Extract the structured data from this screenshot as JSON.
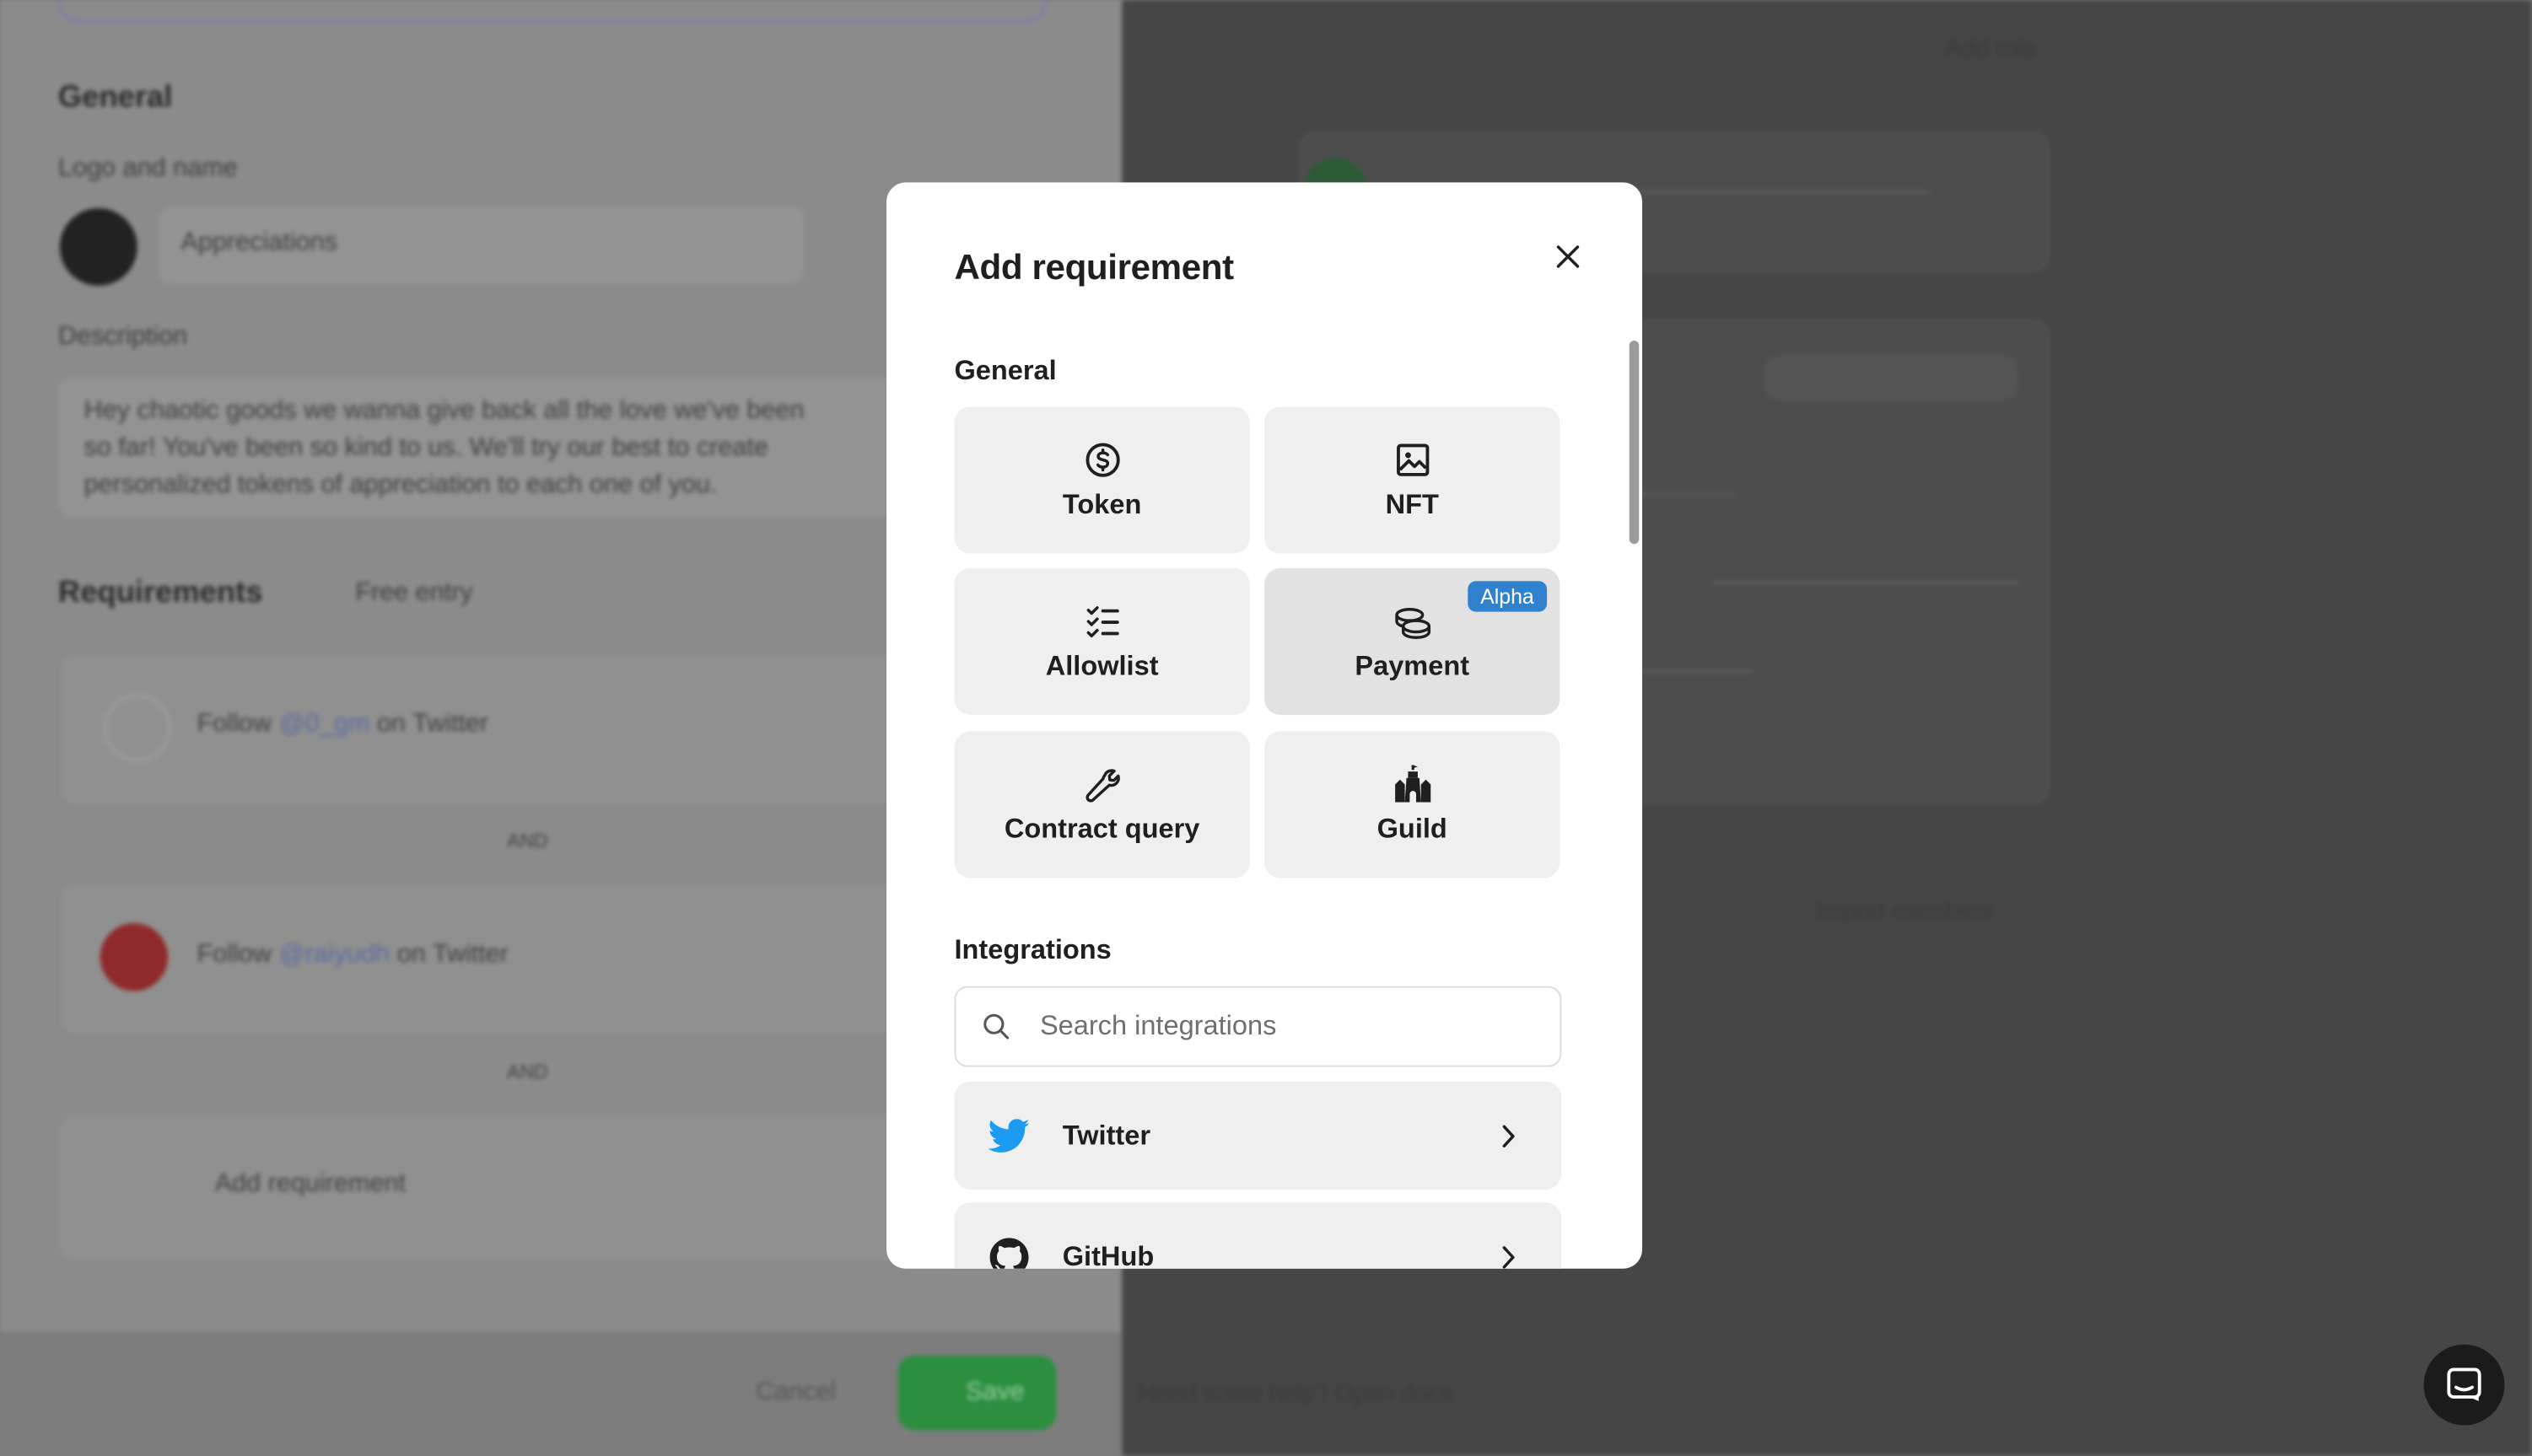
{
  "modal": {
    "title": "Add requirement",
    "general_heading": "General",
    "tiles": [
      {
        "label": "Token",
        "icon": "dollar-coin-icon"
      },
      {
        "label": "NFT",
        "icon": "image-icon"
      },
      {
        "label": "Allowlist",
        "icon": "checklist-icon"
      },
      {
        "label": "Payment",
        "icon": "coins-icon",
        "badge": "Alpha"
      },
      {
        "label": "Contract query",
        "icon": "wrench-icon"
      },
      {
        "label": "Guild",
        "icon": "castle-icon"
      }
    ],
    "integrations_heading": "Integrations",
    "search_placeholder": "Search integrations",
    "integrations": [
      {
        "label": "Twitter",
        "icon": "twitter-icon",
        "color": "#1d9bf0"
      },
      {
        "label": "GitHub",
        "icon": "github-icon",
        "color": "#1f1f1f"
      }
    ]
  },
  "background": {
    "general_heading": "General",
    "logo_label": "Logo and name",
    "name_value": "Appreciations",
    "description_label": "Description",
    "description_lines": [
      "Hey chaotic goods we wanna give back all the love we've been",
      "so far! You've been so kind to us. We'll try our best to create",
      "personalized tokens of appreciation to each one of you."
    ],
    "requirements_heading": "Requirements",
    "free_entry": "Free entry",
    "req1": {
      "prefix": "Follow",
      "handle": "@0_gm",
      "suffix": "on Twitter"
    },
    "req2": {
      "prefix": "Follow",
      "handle": "@raiyudh",
      "suffix": "on Twitter"
    },
    "and_label": "AND",
    "add_requirement": "Add requirement",
    "cancel": "Cancel",
    "save": "Save",
    "right_top": "Add role",
    "right_note": "Need some help? Open docs",
    "right_import": "Import members"
  },
  "colors": {
    "accent": "#3182ce",
    "save_green": "#2a8f3f"
  }
}
